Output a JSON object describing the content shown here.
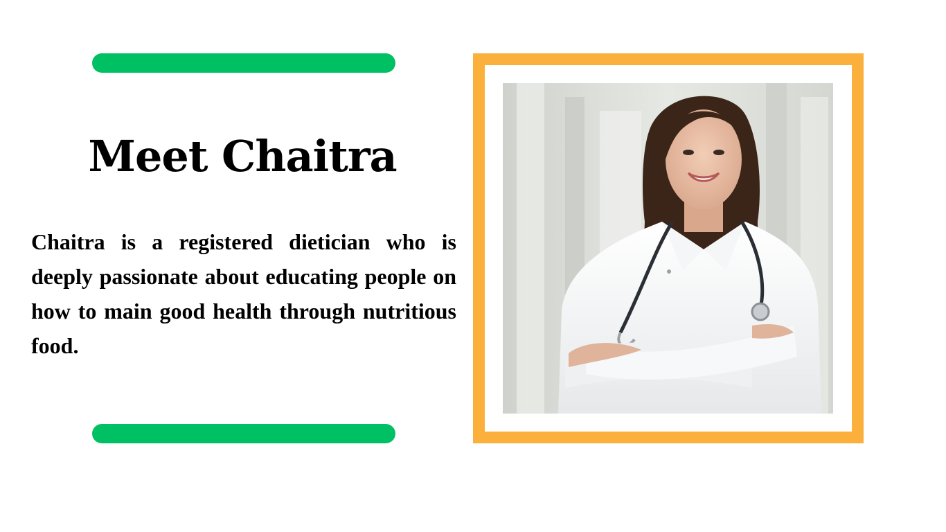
{
  "slide": {
    "title": "Meet Chaitra",
    "bio": "Chaitra is a registered dietician who is deeply passionate about educating people on how to main good health through nutritious food."
  },
  "colors": {
    "accent_bar": "#00C064",
    "frame": "#FBB03B",
    "background": "#FFFFFF",
    "text": "#000000"
  },
  "photo": {
    "subject": "smiling doctor in white coat with stethoscope, arms crossed"
  }
}
